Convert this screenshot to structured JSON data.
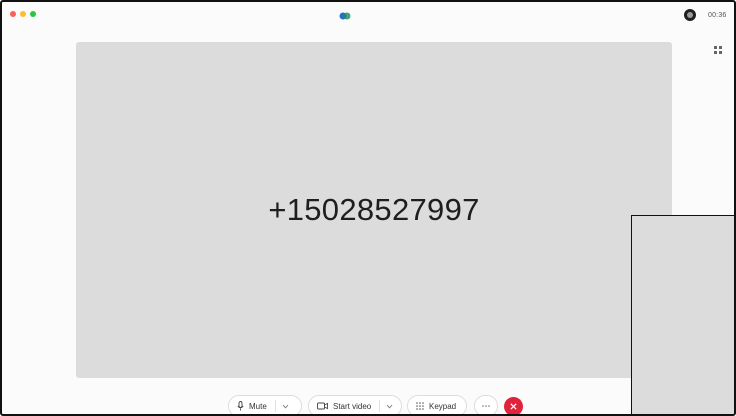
{
  "window": {
    "accent": "#e0223c",
    "background": "#fbfbfb",
    "video_background": "#dcdcdc"
  },
  "titlebar": {
    "traffic_lights": [
      "close",
      "minimize",
      "zoom"
    ],
    "app_icon": "webex-logo-icon",
    "status_icon": "connection-status-icon",
    "timer": "00:36",
    "layout_icon": "grid-layout-icon"
  },
  "main": {
    "caller_number": "+15028527997"
  },
  "controls": {
    "mute_label": "Mute",
    "mute_icon": "microphone-icon",
    "start_video_label": "Start video",
    "start_video_icon": "camera-icon",
    "keypad_label": "Keypad",
    "keypad_icon": "keypad-icon",
    "more_icon": "more-options-icon",
    "end_call_icon": "end-call-icon"
  }
}
